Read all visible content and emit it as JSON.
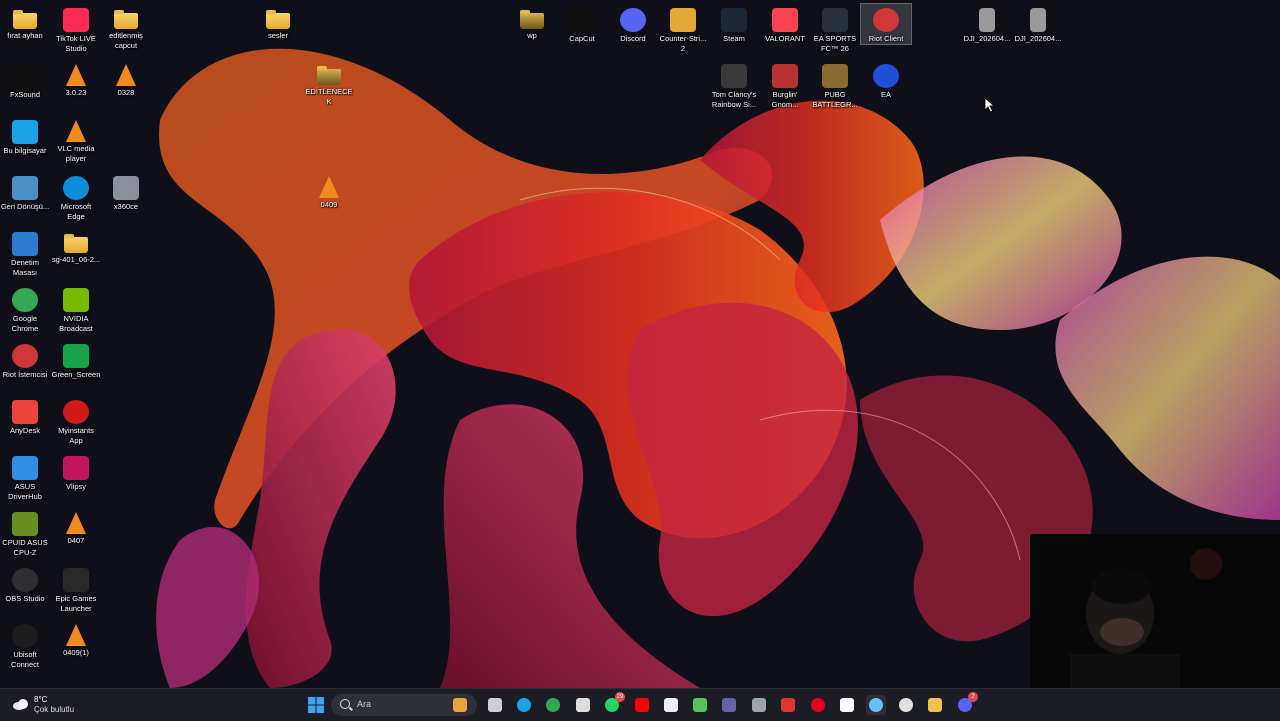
{
  "desktop": {
    "icons": [
      {
        "id": "firat-ayhan",
        "label": "fırat ayhan",
        "kind": "folder",
        "color": "#f2c24d"
      },
      {
        "id": "fxsound",
        "label": "FxSound",
        "kind": "app",
        "color": "#111111"
      },
      {
        "id": "bu-bilgisayar",
        "label": "Bu bilgisayar",
        "kind": "app",
        "color": "#1aa3e8"
      },
      {
        "id": "geri-donusum",
        "label": "Geri Dönüşü...",
        "kind": "app",
        "color": "#4a90c8"
      },
      {
        "id": "denetim-masasi",
        "label": "Denetim Masası",
        "kind": "app",
        "color": "#2d7bd1"
      },
      {
        "id": "google-chrome",
        "label": "Google Chrome",
        "kind": "app",
        "color": "#34a853"
      },
      {
        "id": "riot-istemcisi",
        "label": "Riot İstemcisi",
        "kind": "app",
        "color": "#d13639"
      },
      {
        "id": "anydesk",
        "label": "AnyDesk",
        "kind": "app",
        "color": "#ef443b"
      },
      {
        "id": "asus-driverhub",
        "label": "ASUS DriverHub",
        "kind": "app",
        "color": "#2f8ee6"
      },
      {
        "id": "cpuid",
        "label": "CPUID ASUS CPU-Z",
        "kind": "app",
        "color": "#6b8e23"
      },
      {
        "id": "obs-studio",
        "label": "OBS Studio",
        "kind": "app",
        "color": "#302e31"
      },
      {
        "id": "ubisoft-connect",
        "label": "Ubisoft Connect",
        "kind": "app",
        "color": "#1d1d1d"
      },
      {
        "id": "tiktok-live",
        "label": "TikTok LIVE Studio",
        "kind": "app",
        "color": "#fe2c55"
      },
      {
        "id": "vlc-3023",
        "label": "3.0.23",
        "kind": "vlc",
        "color": "#f08a1c"
      },
      {
        "id": "vlc-player",
        "label": "VLC media player",
        "kind": "vlc",
        "color": "#f08a1c"
      },
      {
        "id": "ms-edge",
        "label": "Microsoft Edge",
        "kind": "app",
        "color": "#0e8ed8"
      },
      {
        "id": "sg-401",
        "label": "sg-401_06-2...",
        "kind": "folder",
        "color": "#f2c24d"
      },
      {
        "id": "nvidia-broadcast",
        "label": "NVIDIA Broadcast",
        "kind": "app",
        "color": "#76b900"
      },
      {
        "id": "green-screen",
        "label": "Green_Screen",
        "kind": "app",
        "color": "#16a34a"
      },
      {
        "id": "myinstants",
        "label": "Myinstants App",
        "kind": "app",
        "color": "#d11a1a"
      },
      {
        "id": "vlipsy",
        "label": "Vlipsy",
        "kind": "app",
        "color": "#c2185b"
      },
      {
        "id": "vlc-0407",
        "label": "0407",
        "kind": "vlc",
        "color": "#f08a1c"
      },
      {
        "id": "epic-games",
        "label": "Epic Games Launcher",
        "kind": "app",
        "color": "#2a2a2a"
      },
      {
        "id": "vlc-0409-1",
        "label": "0409(1)",
        "kind": "vlc",
        "color": "#f08a1c"
      },
      {
        "id": "editlenmis-capcut",
        "label": "editlenmiş capcut",
        "kind": "folder",
        "color": "#f2c24d"
      },
      {
        "id": "vlc-0328",
        "label": "0328",
        "kind": "vlc",
        "color": "#f08a1c"
      },
      {
        "id": "x360ce",
        "label": "x360ce",
        "kind": "app",
        "color": "#8a8fa0"
      },
      {
        "id": "sesler",
        "label": "sesler",
        "kind": "folder",
        "color": "#f2c24d"
      },
      {
        "id": "editlenecek",
        "label": "EDİTLENECEK",
        "kind": "folder",
        "color": "#c9a24a"
      },
      {
        "id": "vlc-0409",
        "label": "0409",
        "kind": "vlc",
        "color": "#f08a1c"
      },
      {
        "id": "wp",
        "label": "wp",
        "kind": "folder",
        "color": "#c9a24a"
      },
      {
        "id": "capcut",
        "label": "CapCut",
        "kind": "app",
        "color": "#111111"
      },
      {
        "id": "discord",
        "label": "Discord",
        "kind": "app",
        "color": "#5865f2"
      },
      {
        "id": "counter-strike",
        "label": "Counter-Stri... 2",
        "kind": "app",
        "color": "#e3a735"
      },
      {
        "id": "steam",
        "label": "Steam",
        "kind": "app",
        "color": "#1b2838"
      },
      {
        "id": "valorant",
        "label": "VALORANT",
        "kind": "app",
        "color": "#fa4454"
      },
      {
        "id": "ea-sports-fc",
        "label": "EA SPORTS FC™ 26",
        "kind": "app",
        "color": "#27303b"
      },
      {
        "id": "riot-client",
        "label": "Riot Client",
        "kind": "app",
        "color": "#d13639",
        "selected": true
      },
      {
        "id": "dji-1",
        "label": "DJI_202604...",
        "kind": "file",
        "color": "#9a9a9a"
      },
      {
        "id": "dji-2",
        "label": "DJI_202604...",
        "kind": "file",
        "color": "#9a9a9a"
      },
      {
        "id": "rainbow-six",
        "label": "Tom Clancy's Rainbow Si...",
        "kind": "app",
        "color": "#3a3a3a"
      },
      {
        "id": "burglin-gnomes",
        "label": "Burglin' Gnom...",
        "kind": "app",
        "color": "#b83232"
      },
      {
        "id": "pubg",
        "label": "PUBG BATTLEGR...",
        "kind": "app",
        "color": "#8a6a30"
      },
      {
        "id": "ea",
        "label": "EA",
        "kind": "app",
        "color": "#1f4fd6"
      }
    ]
  },
  "taskbar": {
    "weather": {
      "temp": "8°C",
      "condition": "Çok bulutlu"
    },
    "search": {
      "placeholder": "Ara"
    },
    "apps": [
      {
        "id": "start",
        "icon": "windows-logo-icon",
        "color": "#3ba4f4"
      },
      {
        "id": "widgets",
        "icon": "tiger-widgets-icon",
        "color": "#e9a23b"
      },
      {
        "id": "task-view",
        "icon": "task-view-icon",
        "color": "#cfcfcf"
      },
      {
        "id": "edge",
        "icon": "edge-icon",
        "color": "#1aa3e8"
      },
      {
        "id": "chrome",
        "icon": "chrome-icon",
        "color": "#34a853"
      },
      {
        "id": "capcut",
        "icon": "capcut-icon",
        "color": "#dddddd"
      },
      {
        "id": "whatsapp",
        "icon": "whatsapp-icon",
        "color": "#25d366",
        "badge": "29"
      },
      {
        "id": "youtube",
        "icon": "youtube-icon",
        "color": "#ff0000"
      },
      {
        "id": "x",
        "icon": "x-icon",
        "color": "#eeeeee"
      },
      {
        "id": "media",
        "icon": "play-icon",
        "color": "#55c25a"
      },
      {
        "id": "teams",
        "icon": "teams-icon",
        "color": "#6264a7"
      },
      {
        "id": "settings",
        "icon": "gear-icon",
        "color": "#9aa4b2"
      },
      {
        "id": "redapp",
        "icon": "red-app-icon",
        "color": "#e0342f"
      },
      {
        "id": "pinterest",
        "icon": "pinterest-icon",
        "color": "#e60023"
      },
      {
        "id": "fxsound",
        "icon": "fxsound-icon",
        "color": "#ffffff"
      },
      {
        "id": "steam",
        "icon": "steam-icon",
        "color": "#66c0f4"
      },
      {
        "id": "xbox",
        "icon": "xbox-icon",
        "color": "#e0e0e0"
      },
      {
        "id": "explorer",
        "icon": "folder-icon",
        "color": "#f2c24d"
      },
      {
        "id": "discord",
        "icon": "discord-icon",
        "color": "#5865f2",
        "badge": "2"
      }
    ]
  }
}
